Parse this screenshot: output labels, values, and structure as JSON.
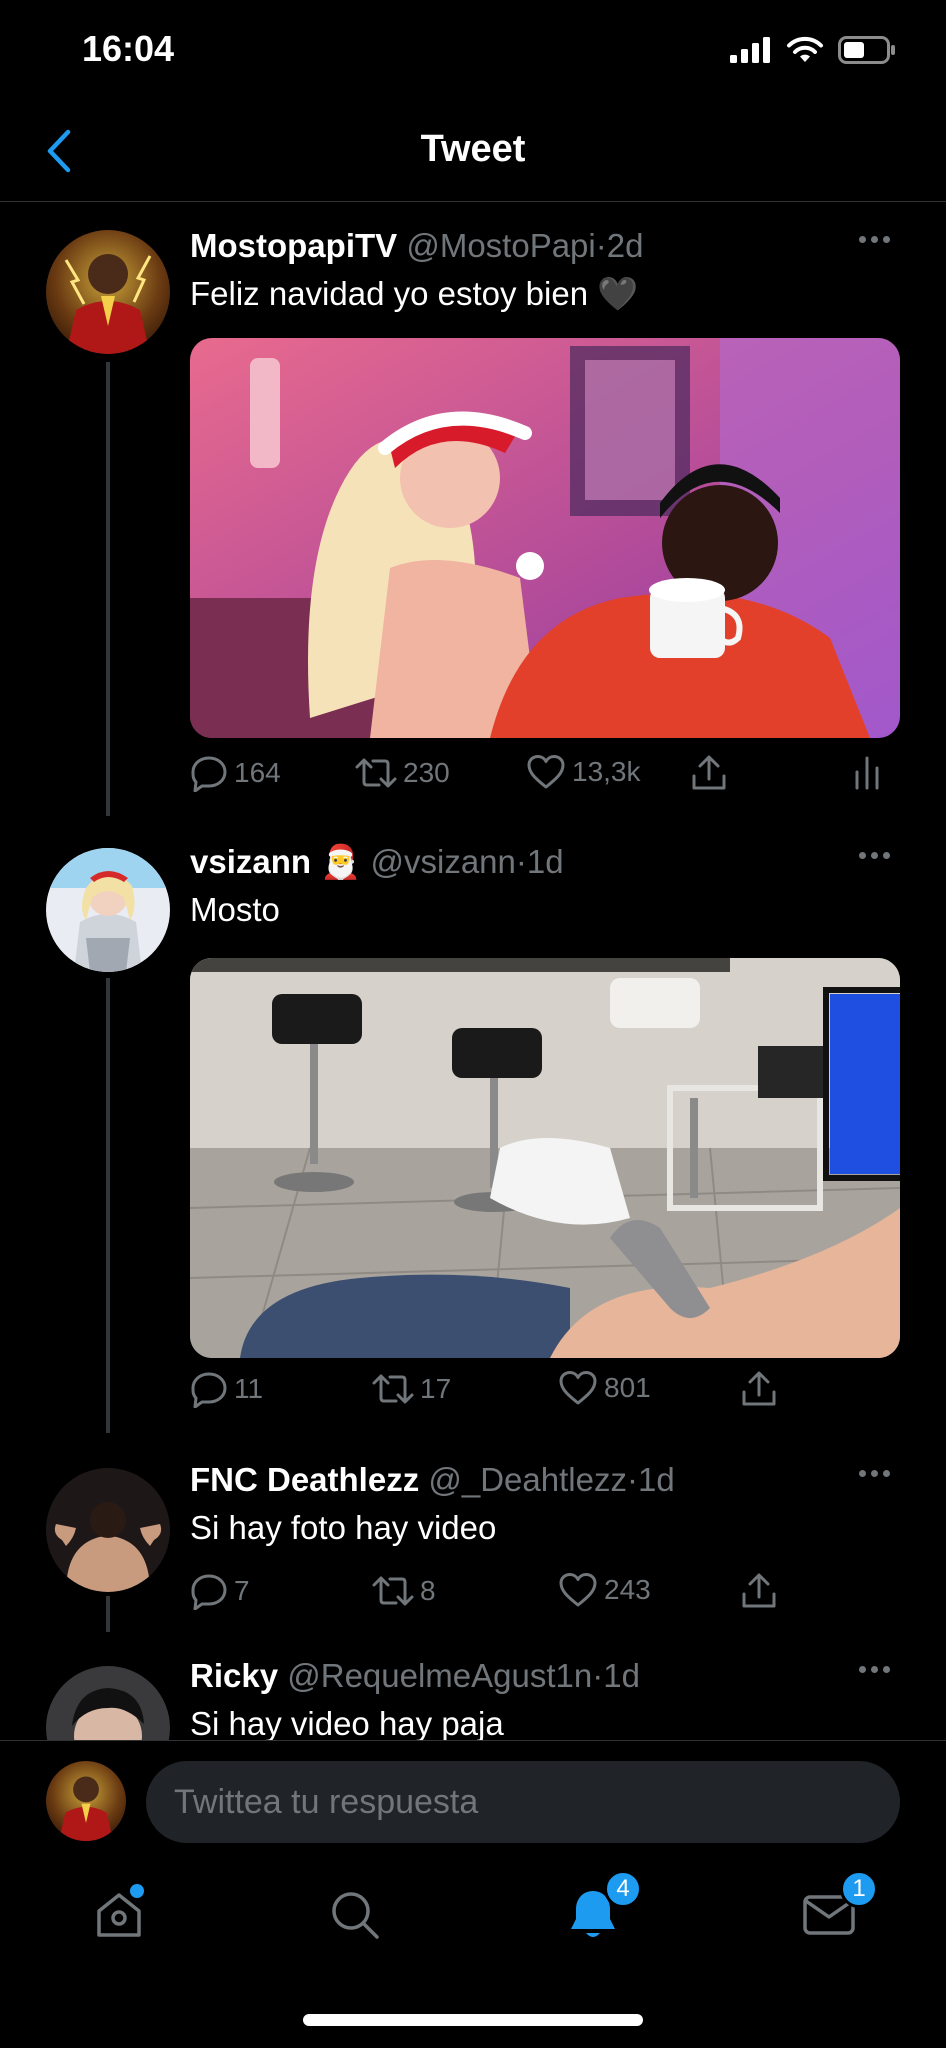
{
  "status_bar": {
    "time": "16:04"
  },
  "nav": {
    "title": "Tweet"
  },
  "tweets": [
    {
      "name": "MostopapiTV",
      "handle": "@MostoPapi",
      "dot": "·",
      "time": "2d",
      "text": "Feliz navidad yo estoy bien 🖤",
      "replies": "164",
      "retweets": "230",
      "likes": "13,3k"
    },
    {
      "name": "vsizann",
      "badge_emoji": "🎅",
      "handle": "@vsizann",
      "dot": "·",
      "time": "1d",
      "text": "Mosto",
      "replies": "11",
      "retweets": "17",
      "likes": "801"
    },
    {
      "name": "FNC Deathlezz",
      "handle": "@_Deahtlezz",
      "dot": "·",
      "time": "1d",
      "text": "Si hay foto hay video",
      "replies": "7",
      "retweets": "8",
      "likes": "243"
    },
    {
      "name": "Ricky",
      "handle": "@RequelmeAgust1n",
      "dot": "·",
      "time": "1d",
      "text": "Si hay video hay paja"
    }
  ],
  "reply": {
    "placeholder": "Twittea tu respuesta"
  },
  "tab_bar": {
    "notifications_badge": "4",
    "messages_badge": "1"
  },
  "colors": {
    "accent": "#1d9bf0",
    "background": "#000000",
    "muted": "#71767b"
  }
}
